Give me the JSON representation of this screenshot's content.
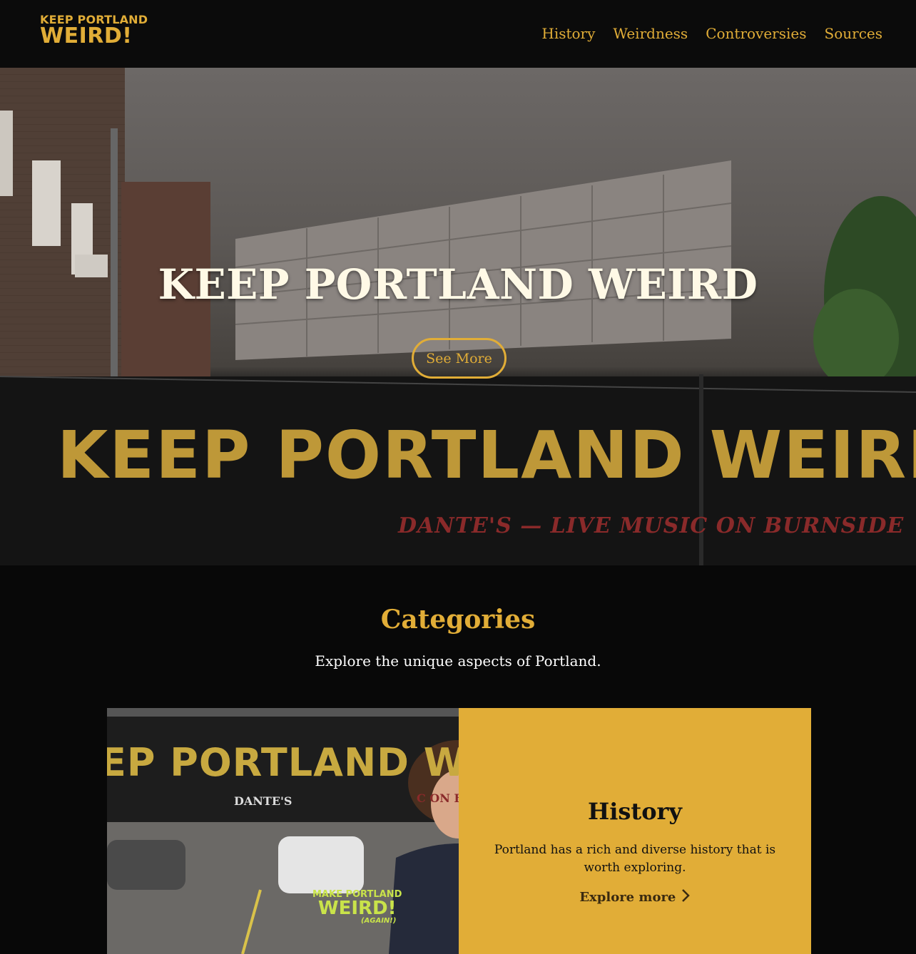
{
  "header": {
    "logo_line1": "KEEP PORTLAND",
    "logo_line2": "WEIRD!",
    "nav": [
      "History",
      "Weirdness",
      "Controversies",
      "Sources"
    ]
  },
  "hero": {
    "title": "KEEP PORTLAND WEIRD",
    "button_label": "See More",
    "wall_sign": "KEEP PORTLAND WEIRD",
    "wall_subsign": "DANTE'S — LIVE MUSIC ON BURNSIDE"
  },
  "categories": {
    "title": "Categories",
    "subtitle": "Explore the unique aspects of Portland.",
    "card": {
      "title": "History",
      "description": "Portland has a rich and diverse history that is worth exploring.",
      "link_label": "Explore more",
      "image_mural": "EP PORTLAND WE",
      "image_mural_sub1": "DANTE'S",
      "image_mural_sub2": "C ON BU",
      "shirt_line1": "MAKE PORTLAND",
      "shirt_line2": "WEIRD!",
      "shirt_line3": "(AGAIN!)"
    }
  },
  "colors": {
    "accent": "#e1ad37",
    "background": "#080808",
    "hero_title": "#fff9e6"
  }
}
